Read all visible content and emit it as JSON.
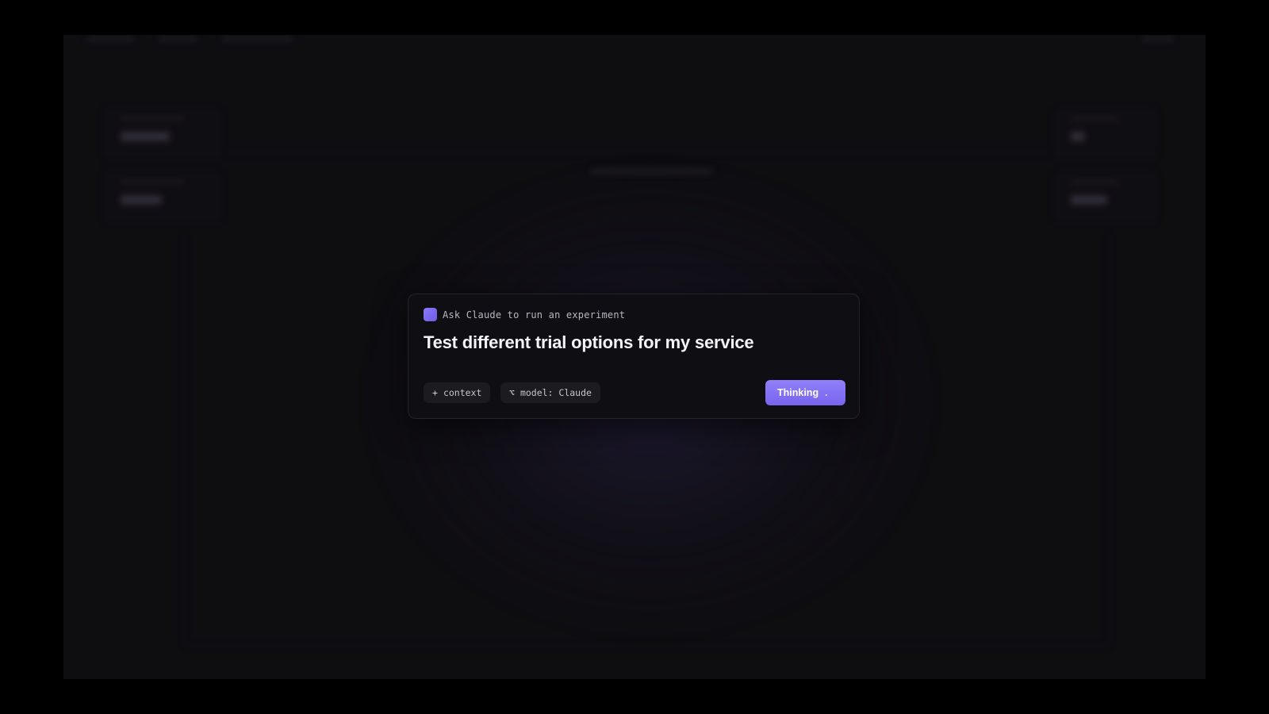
{
  "prompt_card": {
    "header_label": "Ask Claude to run an experiment",
    "prompt_text": "Test different trial options for my service",
    "context_chip": {
      "glyph": "+",
      "label": "context"
    },
    "model_chip": {
      "glyph": "⌥",
      "label": "model: Claude"
    },
    "submit_button": {
      "label": "Thinking",
      "dots": "."
    }
  },
  "colors": {
    "accent": "#7f6ff5",
    "background": "#000000",
    "card_background": "#0f0e12"
  },
  "icons": {
    "header_icon": "claude-square-icon"
  }
}
